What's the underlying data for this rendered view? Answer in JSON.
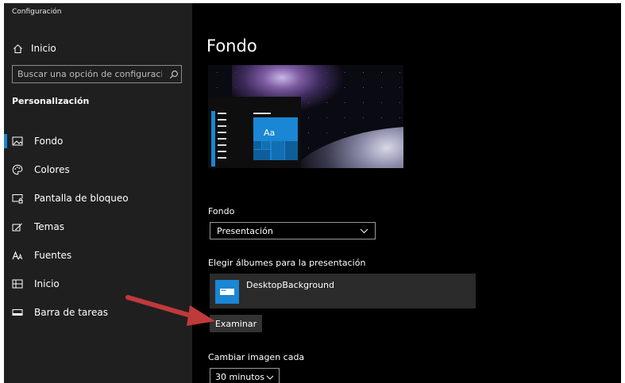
{
  "app": {
    "title": "Configuración"
  },
  "sidebar": {
    "home": {
      "label": "Inicio",
      "icon": "home-icon"
    },
    "search": {
      "placeholder": "Buscar una opción de configuración",
      "icon": "search-icon"
    },
    "section": "Personalización",
    "items": [
      {
        "label": "Fondo",
        "icon": "image-icon",
        "active": true
      },
      {
        "label": "Colores",
        "icon": "palette-icon",
        "active": false
      },
      {
        "label": "Pantalla de bloqueo",
        "icon": "lock-screen-icon",
        "active": false
      },
      {
        "label": "Temas",
        "icon": "theme-icon",
        "active": false
      },
      {
        "label": "Fuentes",
        "icon": "font-icon",
        "active": false
      },
      {
        "label": "Inicio",
        "icon": "start-icon",
        "active": false
      },
      {
        "label": "Barra de tareas",
        "icon": "taskbar-icon",
        "active": false
      }
    ]
  },
  "main": {
    "title": "Fondo",
    "preview": {
      "tile_text": "Aa"
    },
    "background": {
      "label": "Fondo",
      "selected": "Presentación"
    },
    "albums": {
      "label": "Elegir álbumes para la presentación",
      "items": [
        {
          "name": "DesktopBackground"
        }
      ]
    },
    "browse_label": "Examinar",
    "interval": {
      "label": "Cambiar imagen cada",
      "selected": "30 minutos"
    }
  },
  "colors": {
    "accent": "#1a86d4",
    "sidebar_bg": "#1f1f1f",
    "content_bg": "#000000",
    "annotation_arrow": "#c0393b"
  }
}
